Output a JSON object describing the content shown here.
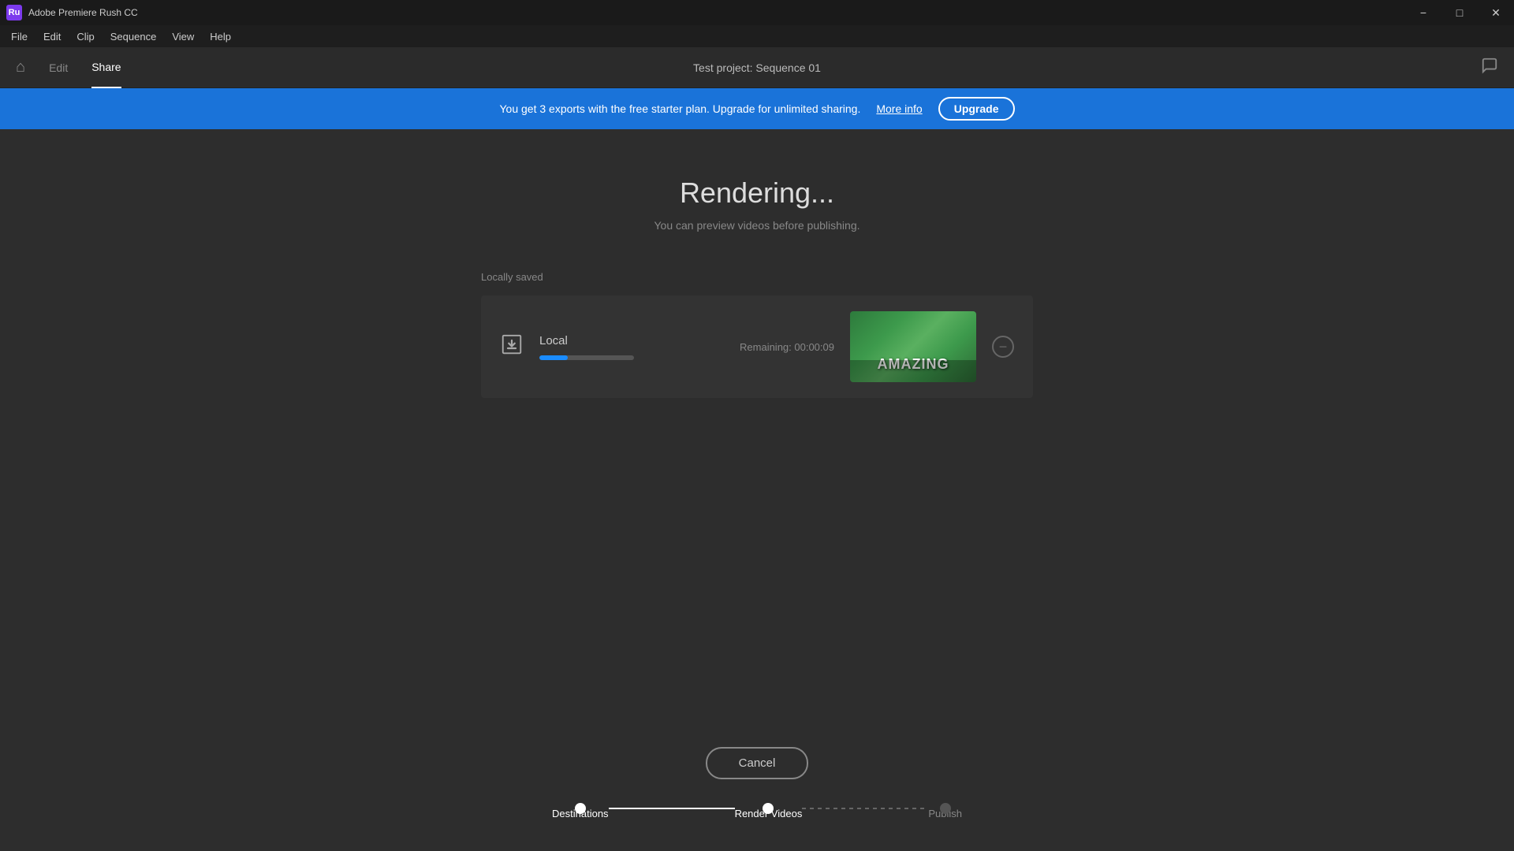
{
  "titlebar": {
    "app_name": "Adobe Premiere Rush CC",
    "app_icon_label": "Ru",
    "min_btn": "−",
    "max_btn": "□",
    "close_btn": "✕"
  },
  "menubar": {
    "items": [
      "File",
      "Edit",
      "Clip",
      "Sequence",
      "View",
      "Help"
    ]
  },
  "navbar": {
    "home_icon": "⌂",
    "edit_label": "Edit",
    "share_label": "Share",
    "project_title": "Test project: Sequence 01",
    "chat_icon": "💬"
  },
  "banner": {
    "text": "You get 3 exports with the free starter plan. Upgrade for unlimited sharing.",
    "more_info_label": "More info",
    "upgrade_label": "Upgrade"
  },
  "main": {
    "rendering_title": "Rendering...",
    "rendering_subtitle": "You can preview videos before publishing.",
    "locally_saved_label": "Locally saved",
    "render_item": {
      "label": "Local",
      "remaining": "Remaining: 00:00:09",
      "progress_percent": 30,
      "thumbnail_text": "AMAZING"
    }
  },
  "bottom": {
    "cancel_label": "Cancel",
    "steps": [
      {
        "label": "Destinations",
        "state": "completed"
      },
      {
        "label": "Render Videos",
        "state": "active"
      },
      {
        "label": "Publish",
        "state": "inactive"
      }
    ]
  }
}
